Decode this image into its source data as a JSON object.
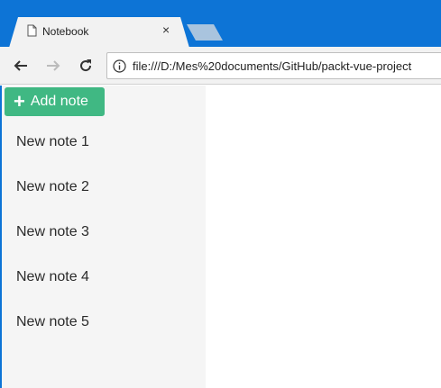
{
  "browser": {
    "tab_title": "Notebook",
    "tab_close": "×",
    "url": "file:///D:/Mes%20documents/GitHub/packt-vue-project"
  },
  "app": {
    "add_note_label": "Add note",
    "add_note_icon": "plus-icon",
    "notes": [
      "New note 1",
      "New note 2",
      "New note 3",
      "New note 4",
      "New note 5"
    ],
    "accent_color": "#40b883"
  },
  "colors": {
    "titlebar": "#0d74d6",
    "toolbar": "#f2f2f2",
    "sidebar": "#f5f5f5"
  }
}
